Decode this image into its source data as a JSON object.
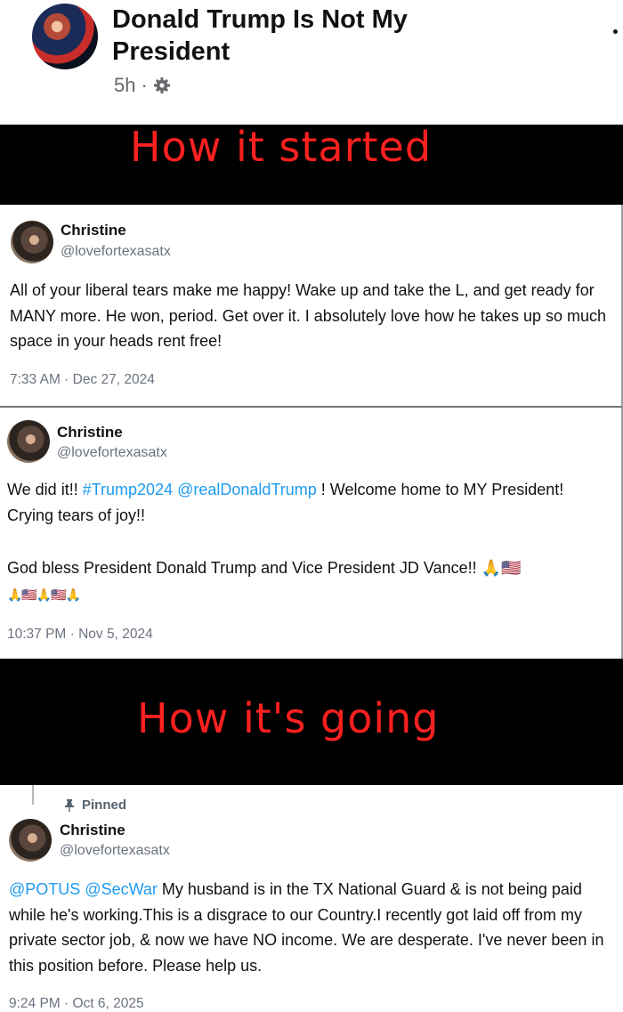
{
  "group": {
    "title": "Donald Trump Is Not My President",
    "time": "5h",
    "separator": "·",
    "settings_icon": "gear-icon",
    "more_icon": "more-icon"
  },
  "banners": {
    "started": "How it started",
    "going": "How it's going"
  },
  "tweets": [
    {
      "name": "Christine",
      "handle": "@lovefortexasatx",
      "text": "All of your liberal tears make me happy! Wake up and take the L, and get ready for MANY more. He won, period. Get over it. I absolutely love how he takes up so much space in your heads rent free!",
      "timestamp": "7:33 AM · Dec 27, 2024"
    },
    {
      "name": "Christine",
      "handle": "@lovefortexasatx",
      "text_before": "We did it!! ",
      "hashtag": "#Trump2024",
      "mention": "@realDonaldTrump",
      "text_after": " ! Welcome home to MY President! Crying tears of joy!!",
      "text_line2": "God bless President Donald Trump and Vice President JD Vance!! 🙏🇺🇸",
      "emoji_line": "🙏🇺🇸🙏🇺🇸🙏",
      "timestamp": "10:37 PM · Nov 5, 2024"
    },
    {
      "pinned": "Pinned",
      "name": "Christine",
      "handle": "@lovefortexasatx",
      "mention1": "@POTUS",
      "mention2": "@SecWar",
      "text": " My husband is in the TX National Guard & is not being paid while he's working.This is a disgrace to our Country.I recently got laid off from my private sector job, & now we have NO income. We are desperate. I've never been in this position before. Please help us.",
      "timestamp": "9:24 PM · Oct 6, 2025"
    }
  ]
}
